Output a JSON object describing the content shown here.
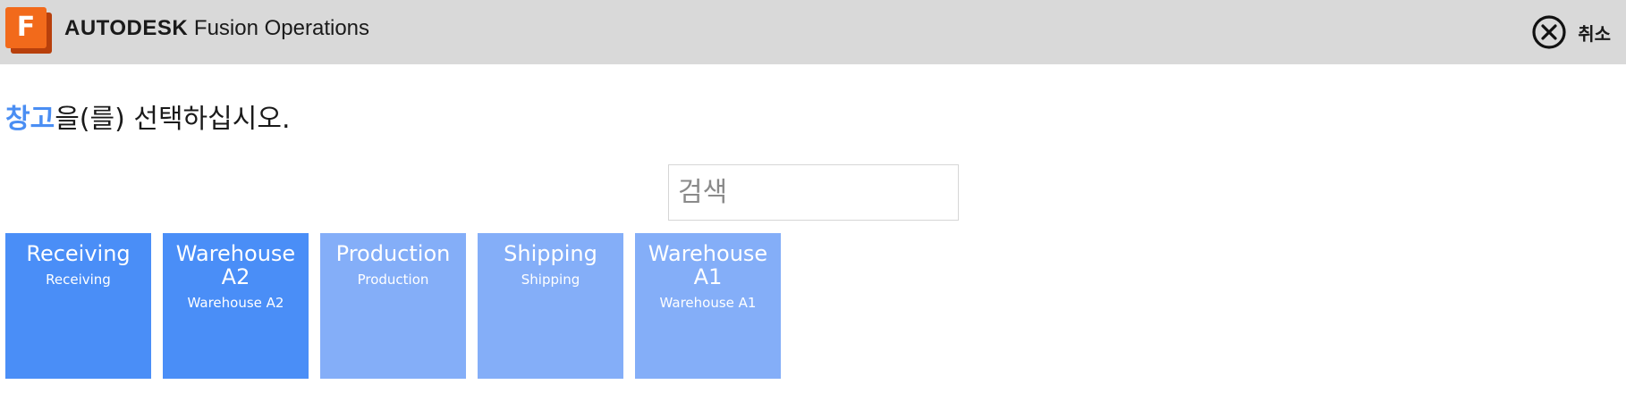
{
  "header": {
    "logo_letter": "F",
    "brand_bold": "AUTODESK",
    "brand_rest": "Fusion Operations",
    "cancel_label": "취소",
    "cancel_icon": "close-circle-icon"
  },
  "prompt": {
    "highlight": "창고",
    "rest": "을(를) 선택하십시오."
  },
  "search": {
    "placeholder": "검색",
    "value": ""
  },
  "colors": {
    "topbar_bg": "#d9d9d9",
    "accent": "#4a8ef3",
    "tile_dark": "#4a8ef7",
    "tile_light": "#84aef8",
    "logo_orange": "#f26a1b"
  },
  "warehouses": [
    {
      "title": "Receiving",
      "subtitle": "Receiving",
      "shade": "dark"
    },
    {
      "title": "Warehouse A2",
      "subtitle": "Warehouse A2",
      "shade": "dark"
    },
    {
      "title": "Production",
      "subtitle": "Production",
      "shade": "light"
    },
    {
      "title": "Shipping",
      "subtitle": "Shipping",
      "shade": "light"
    },
    {
      "title": "Warehouse A1",
      "subtitle": "Warehouse A1",
      "shade": "light"
    }
  ]
}
